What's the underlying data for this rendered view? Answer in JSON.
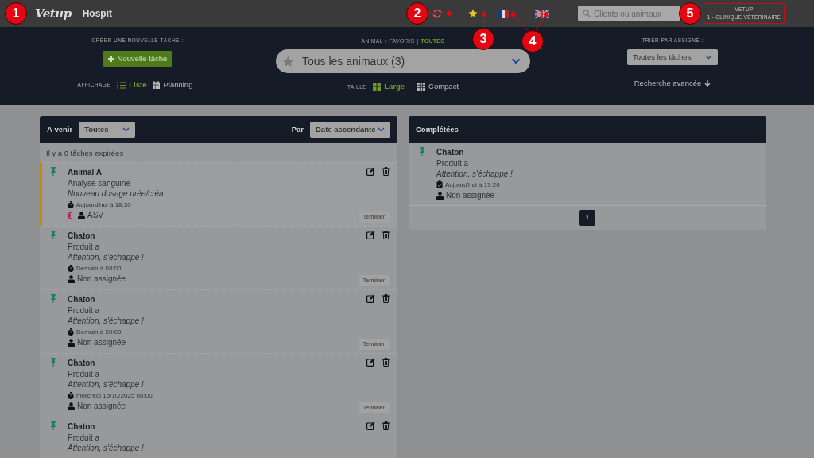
{
  "topbar": {
    "logo": "Vetup",
    "app_name": "Hospit",
    "search": {
      "placeholder": "Clients ou animaux"
    },
    "account": {
      "org": "VETUP",
      "clinic": "1 - CLINIQUE VÉTÉRINAIRE",
      "outlined": true
    }
  },
  "annotations": [
    {
      "number": "1"
    },
    {
      "number": "2"
    },
    {
      "number": "3"
    },
    {
      "number": "4"
    },
    {
      "number": "5"
    }
  ],
  "toolbar": {
    "create_label": "CRÉER UNE NOUVELLE TÂCHE :",
    "new_task_button": "Nouvelle tâche",
    "display_label": "AFFICHAGE",
    "view_options": [
      {
        "label": "Liste",
        "kind": "list",
        "selected": true
      },
      {
        "label": "Planning",
        "kind": "calendar",
        "selected": false
      }
    ],
    "animal_label": "ANIMAL :",
    "filter_separator": "|",
    "animal_filters": [
      {
        "label": "FAVORIS",
        "selected": false
      },
      {
        "label": "TOUTES",
        "selected": true
      }
    ],
    "animal_select": "Tous les animaux (3)",
    "size_label": "TAILLE",
    "size_options": [
      {
        "label": "Large",
        "kind": "large",
        "selected": true
      },
      {
        "label": "Compact",
        "kind": "compact",
        "selected": false
      }
    ],
    "sort_label": "TRIER PAR ASSIGNÉ :",
    "assignee_select": "Toutes les tâches",
    "advanced_search": "Recherche avancée"
  },
  "upcoming": {
    "title": "À venir",
    "filter": "Toutes",
    "sort_label": "Par",
    "sort": "Date ascendante",
    "expired_link": "Il y a 0 tâches expirées",
    "tasks": [
      {
        "animal": "Animal A",
        "task": "Analyse sanguine",
        "note": "Nouveau dosage urée/créa",
        "kind": "due",
        "date": "Aujourd'hui à 18:30",
        "billing": true,
        "assignee": "ASV",
        "highlighted": true,
        "action": "Terminer"
      },
      {
        "animal": "Chaton",
        "task": "Produit a",
        "note": "Attention, s'échappe !",
        "kind": "due",
        "date": "Demain à 08:00",
        "billing": false,
        "assignee": "Non assignée",
        "highlighted": false,
        "action": "Terminer"
      },
      {
        "animal": "Chaton",
        "task": "Produit a",
        "note": "Attention, s'échappe !",
        "kind": "due",
        "date": "Demain à 20:00",
        "billing": false,
        "assignee": "Non assignée",
        "highlighted": false,
        "action": "Terminer"
      },
      {
        "animal": "Chaton",
        "task": "Produit a",
        "note": "Attention, s'échappe !",
        "kind": "due",
        "date": "mercredi 15/10/2025 08:00",
        "billing": false,
        "assignee": "Non assignée",
        "highlighted": false,
        "action": "Terminer"
      },
      {
        "animal": "Chaton",
        "task": "Produit a",
        "note": "Attention, s'échappe !",
        "highlighted": false
      }
    ]
  },
  "completed": {
    "title": "Complétées",
    "tasks": [
      {
        "animal": "Chaton",
        "task": "Produit a",
        "note": "Attention, s'échappe !",
        "kind": "done",
        "date": "Aujourd'hui à 17:20",
        "billing": false,
        "assignee": "Non assignée",
        "highlighted": false
      }
    ],
    "pages": [
      {
        "label": "1",
        "selected": true
      }
    ]
  }
}
